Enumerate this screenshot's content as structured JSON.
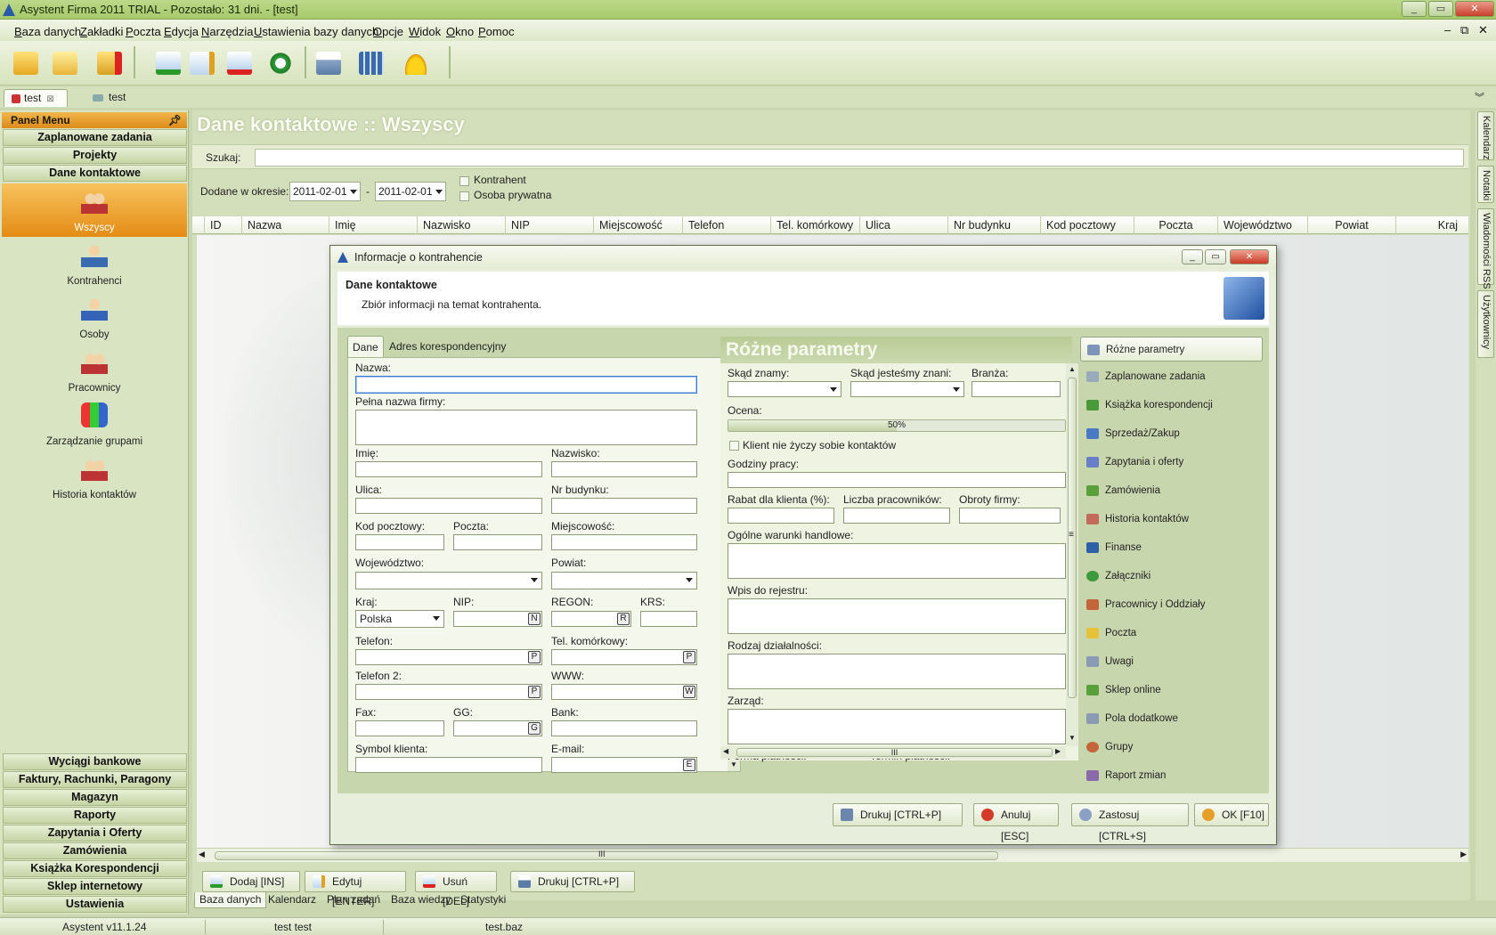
{
  "window": {
    "title": "Asystent Firma 2011 TRIAL - Pozostało: 31 dni. - [test]"
  },
  "menu": [
    {
      "u": "B",
      "rest": "aza danych"
    },
    {
      "u": "Z",
      "rest": "akładki"
    },
    {
      "u": "P",
      "rest": "oczta"
    },
    {
      "u": "E",
      "rest": "dycja"
    },
    {
      "u": "N",
      "rest": "arzędzia"
    },
    {
      "u": "U",
      "rest": "stawienia bazy danych"
    },
    {
      "u": "O",
      "rest": "pcje"
    },
    {
      "u": "W",
      "rest": "idok"
    },
    {
      "u": "O",
      "rest": "kno"
    },
    {
      "u": "P",
      "rest": "omoc"
    }
  ],
  "doc_tabs": [
    "test",
    "test"
  ],
  "panel_menu": {
    "title": "Panel Menu",
    "top_groups": [
      "Zaplanowane zadania",
      "Projekty",
      "Dane kontaktowe"
    ],
    "items": [
      "Wszyscy",
      "Kontrahenci",
      "Osoby",
      "Pracownicy",
      "Zarządzanie grupami",
      "Historia kontaktów"
    ],
    "bottom_groups": [
      "Wyciągi bankowe",
      "Faktury, Rachunki, Paragony",
      "Magazyn",
      "Raporty",
      "Zapytania i Oferty",
      "Zamówienia",
      "Książka Korespondencji",
      "Sklep internetowy",
      "Ustawienia"
    ]
  },
  "main": {
    "title": "Dane kontaktowe :: Wszyscy",
    "search_label": "Szukaj:",
    "period_label": "Dodane w okresie:",
    "date_from": "2011-02-01",
    "date_sep": "-",
    "date_to": "2011-02-01",
    "chk_kontrahent": "Kontrahent",
    "chk_osoba": "Osoba prywatna",
    "columns": [
      "ID",
      "Nazwa",
      "Imię",
      "Nazwisko",
      "NIP",
      "Miejscowość",
      "Telefon",
      "Tel. komórkowy",
      "Ulica",
      "Nr budynku",
      "Kod pocztowy",
      "Poczta",
      "Województwo",
      "Powiat",
      "Kraj"
    ],
    "actions": [
      "Dodaj [INS]",
      "Edytuj [ENTER]",
      "Usuń [DEL]",
      "Drukuj [CTRL+P]"
    ],
    "hscroll_grip": "III"
  },
  "bottom_tabs": [
    "Baza danych",
    "Kalendarz",
    "Plan zadań",
    "Baza wiedzy",
    "Statystyki"
  ],
  "status": [
    "Asystent v11.1.24",
    "test test",
    "test.baz"
  ],
  "right_tabs": [
    "Kalendarz",
    "Notatki",
    "Wiadomości RSS",
    "Użytkownicy"
  ],
  "dialog": {
    "title": "Informacje o kontrahencie",
    "header": "Dane kontaktowe",
    "subheader": "Zbiór informacji na temat kontrahenta.",
    "tabs": [
      "Dane",
      "Adres korespondencyjny"
    ],
    "fields": {
      "nazwa": "Nazwa:",
      "pelna_nazwa": "Pełna nazwa firmy:",
      "imie": "Imię:",
      "nazwisko": "Nazwisko:",
      "ulica": "Ulica:",
      "nr_budynku": "Nr budynku:",
      "kod_pocztowy": "Kod pocztowy:",
      "poczta": "Poczta:",
      "miejscowosc": "Miejscowość:",
      "wojewodztwo": "Województwo:",
      "powiat": "Powiat:",
      "kraj": "Kraj:",
      "kraj_value": "Polska",
      "nip": "NIP:",
      "regon": "REGON:",
      "krs": "KRS:",
      "telefon": "Telefon:",
      "tel_kom": "Tel. komórkowy:",
      "telefon2": "Telefon 2:",
      "www": "WWW:",
      "fax": "Fax:",
      "gg": "GG:",
      "bank": "Bank:",
      "symbol": "Symbol klienta:",
      "email": "E-mail:"
    },
    "field_btns": {
      "n": "N",
      "r": "R",
      "p": "P",
      "w": "W",
      "g": "G",
      "e": "E"
    },
    "params": {
      "title": "Różne parametry",
      "skad_znamy": "Skąd znamy:",
      "skad_jestesmy": "Skąd jesteśmy znani:",
      "branza": "Branża:",
      "ocena": "Ocena:",
      "ocena_value": 0.5,
      "ocena_text": "50%",
      "no_contact": "Klient nie życzy sobie kontaktów",
      "godziny": "Godziny pracy:",
      "rabat": "Rabat dla klienta (%):",
      "liczba_prac": "Liczba pracowników:",
      "obroty": "Obroty firmy:",
      "warunki": "Ogólne warunki handlowe:",
      "rejestr": "Wpis do rejestru:",
      "rodzaj": "Rodzaj działalności:",
      "zarzad": "Zarząd:",
      "forma": "Forma płatności:",
      "termin": "Termin płatności:",
      "hgrip": "III",
      "vgrip": "≡"
    },
    "nav": [
      "Różne parametry",
      "Zaplanowane zadania",
      "Książka korespondencji",
      "Sprzedaż/Zakup",
      "Zapytania i oferty",
      "Zamówienia",
      "Historia kontaktów",
      "Finanse",
      "Załączniki",
      "Pracownicy i Oddziały",
      "Poczta",
      "Uwagi",
      "Sklep online",
      "Pola dodatkowe",
      "Grupy",
      "Raport zmian"
    ],
    "buttons": [
      "Drukuj [CTRL+P]",
      "Anuluj [ESC]",
      "Zastosuj [CTRL+S]",
      "OK [F10]"
    ]
  },
  "colors": {
    "accent_orange": "#e48c14",
    "frame_green": "#a6c96a",
    "focus_blue": "#3d7bd2"
  }
}
